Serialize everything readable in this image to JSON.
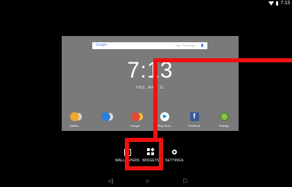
{
  "status": {
    "time": "7:13"
  },
  "preview": {
    "search_logo": "Google",
    "search_hint": "Say \"Ok Google\"",
    "clock": "7:13",
    "date": "THU, MAY 11"
  },
  "apps": [
    {
      "label": "Utilities",
      "icon": "utilities-folder-icon",
      "color": "#f0a830"
    },
    {
      "label": "",
      "icon": "blue-folder-icon",
      "color": "#2a7fd4"
    },
    {
      "label": "Google",
      "icon": "google-folder-icon",
      "color": "#e04a3c"
    },
    {
      "label": "Play Store",
      "icon": "play-store-icon",
      "color": "#ffffff"
    },
    {
      "label": "Facebook",
      "icon": "facebook-icon",
      "color": "#3b5998"
    },
    {
      "label": "Settings",
      "icon": "settings-gear-icon",
      "color": "#8bc34a"
    }
  ],
  "menu": {
    "wallpapers": "WALLPAPERS",
    "widgets": "WIDGETS",
    "settings": "SETTINGS"
  },
  "nav": {
    "back": "◁",
    "home": "○",
    "recents": "□"
  },
  "colors": {
    "highlight": "#ee1111",
    "preview_bg": "#7a7a7a"
  }
}
